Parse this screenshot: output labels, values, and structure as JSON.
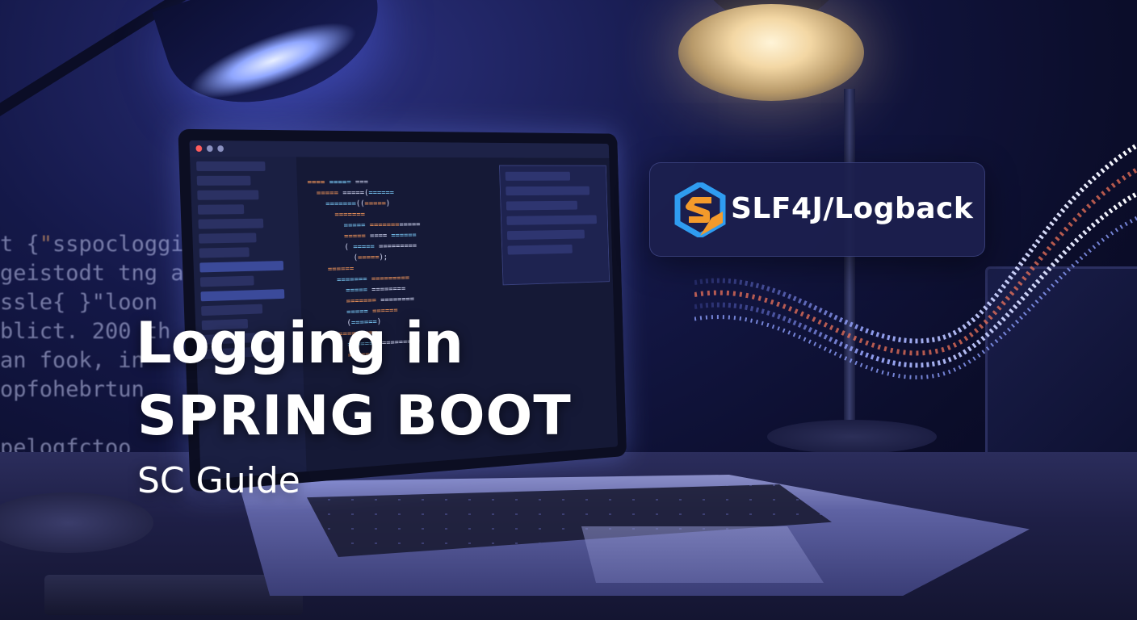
{
  "title": {
    "line1": "Logging in",
    "line2": "SPRING BOOT",
    "subtitle": "SC Guide"
  },
  "badge": {
    "text": "SLF4J/Logback",
    "logo_icon": "hexagon-s-logo-icon"
  },
  "colors": {
    "background": "#0b0d2a",
    "badge_bg": "#1c204e",
    "logo_blue": "#2f9cf0",
    "logo_orange": "#f39a2b",
    "title": "#ffffff"
  }
}
